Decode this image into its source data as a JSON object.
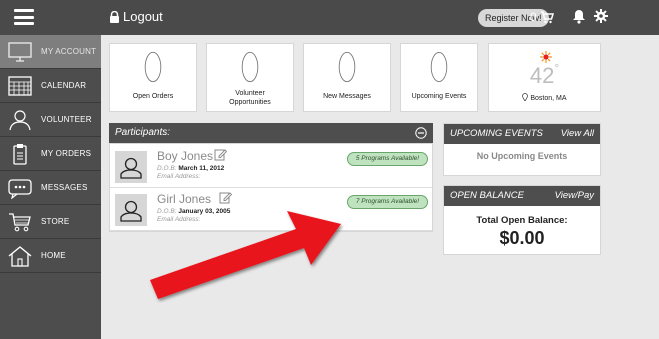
{
  "header": {
    "logout_label": "Logout",
    "register_label": "Register Now!",
    "cart_count": "0"
  },
  "sidebar": {
    "items": [
      {
        "label": "MY ACCOUNT",
        "icon": "monitor-icon",
        "active": true
      },
      {
        "label": "CALENDAR",
        "icon": "calendar-icon"
      },
      {
        "label": "VOLUNTEER",
        "icon": "person-icon"
      },
      {
        "label": "MY ORDERS",
        "icon": "clipboard-icon"
      },
      {
        "label": "MESSAGES",
        "icon": "chat-icon"
      },
      {
        "label": "STORE",
        "icon": "cart-icon"
      },
      {
        "label": "HOME",
        "icon": "home-icon"
      }
    ]
  },
  "stats": {
    "open_orders": {
      "value": "0",
      "label": "Open Orders"
    },
    "volunteer": {
      "value": "0",
      "label_line1": "Volunteer",
      "label_line2": "Opportunities"
    },
    "new_messages": {
      "value": "0",
      "label": "New Messages"
    },
    "upcoming_events": {
      "value": "0",
      "label": "Upcoming Events"
    },
    "weather": {
      "temp": "42",
      "unit": "°",
      "location": "Boston, MA",
      "icon": "sun-icon"
    }
  },
  "participants": {
    "title": "Participants:",
    "list": [
      {
        "name": "Boy Jones",
        "dob_label": "D.O.B:",
        "dob": "March 11, 2012",
        "email_label": "Email Address:",
        "programs": "5 Programs Available!"
      },
      {
        "name": "Girl Jones",
        "dob_label": "D.O.B:",
        "dob": "January 03, 2005",
        "email_label": "Email Address:",
        "programs": "7 Programs Available!"
      }
    ]
  },
  "upcoming": {
    "title": "UPCOMING EVENTS",
    "link": "View All",
    "empty": "No Upcoming Events"
  },
  "balance": {
    "title": "OPEN BALANCE",
    "link": "View/Pay",
    "label": "Total Open Balance:",
    "amount": "$0.00"
  },
  "colors": {
    "topbar": "#4a4a4a",
    "sidebar": "#4d4d4d",
    "badge_green": "#bfe2bf",
    "arrow_red": "#e8141b"
  }
}
